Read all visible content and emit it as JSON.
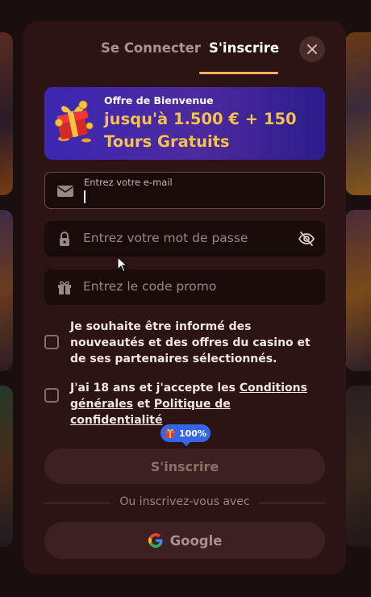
{
  "tabs": {
    "login": "Se Connecter",
    "signup": "S'inscrire",
    "active": "signup"
  },
  "banner": {
    "title": "Offre de Bienvenue",
    "text": "jusqu'à 1.500 € + 150 Tours Gratuits",
    "icon": "gift-icon"
  },
  "email": {
    "label": "Entrez votre e-mail",
    "value": "",
    "icon": "envelope-icon"
  },
  "password": {
    "placeholder": "Entrez votre mot de passe",
    "icon": "lock-icon",
    "toggle_icon": "eye-off-icon"
  },
  "promo": {
    "placeholder": "Entrez le code promo",
    "icon": "gift-icon"
  },
  "checks": {
    "newsletter": {
      "text": "Je souhaite être informé des nouveautés et des offres du casino et de ses partenaires sélectionnés.",
      "checked": false
    },
    "terms": {
      "prefix": "J'ai 18 ans et j'accepte les ",
      "terms_link": "Conditions générales",
      "middle": " et ",
      "privacy_link": "Politique de confidentialité",
      "checked": false
    }
  },
  "progress_badge": {
    "text": "100%",
    "value": 1.0
  },
  "submit_label": "S'inscrire",
  "divider_text": "Ou inscrivez-vous avec",
  "google_label": "Google",
  "colors": {
    "accent": "#f0b55a",
    "modal_bg": "#2d1414",
    "banner_gradient_start": "#3b27b3",
    "offer_text": "#f5c14a",
    "badge": "#3566e8"
  }
}
